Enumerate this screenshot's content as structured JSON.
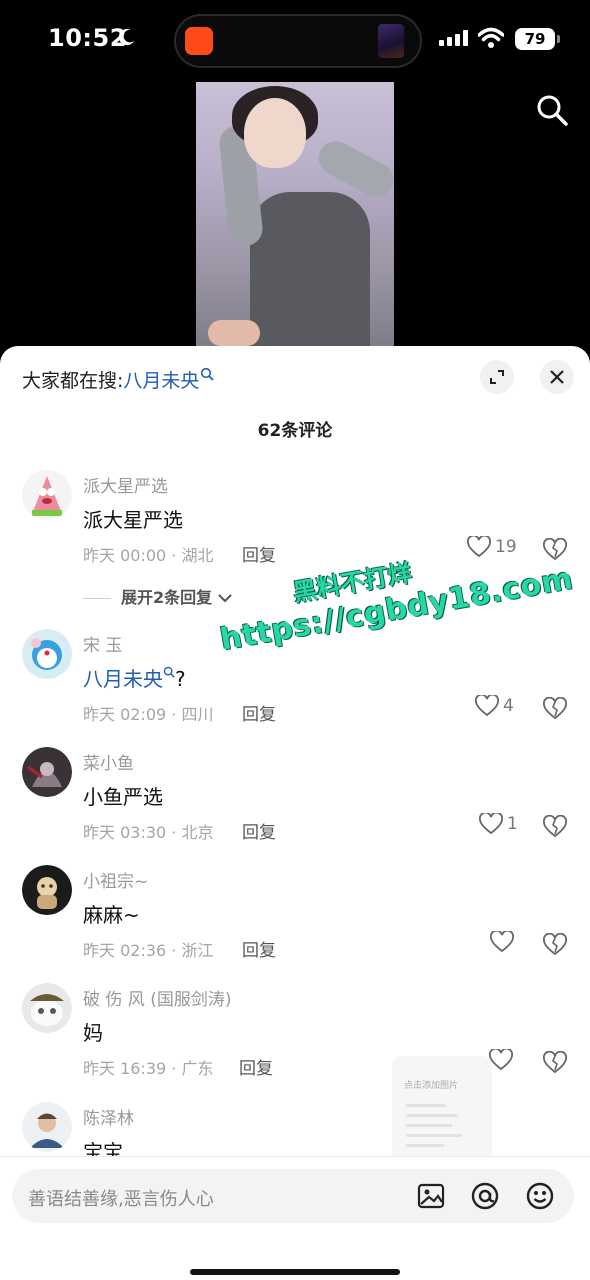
{
  "status_bar": {
    "time": "10:52",
    "battery": "79"
  },
  "sheet": {
    "search_prefix": "大家都在搜:",
    "search_keyword": "八月未央",
    "comment_count": "62条评论",
    "expand_replies": "展开2条回复"
  },
  "comments": [
    {
      "user": "派大星严选",
      "text": "派大星严选",
      "text_keyword": "",
      "text_suffix": "",
      "meta": "昨天 00:00 · 湖北",
      "reply": "回复",
      "likes": "19"
    },
    {
      "user": "宋 玉",
      "text": "",
      "text_keyword": "八月未央",
      "text_suffix": "?",
      "meta": "昨天 02:09 · 四川",
      "reply": "回复",
      "likes": "4"
    },
    {
      "user": "菜小鱼",
      "text": "小鱼严选",
      "text_keyword": "",
      "text_suffix": "",
      "meta": "昨天 03:30 · 北京",
      "reply": "回复",
      "likes": "1"
    },
    {
      "user": "小祖宗~",
      "text": "麻麻~",
      "text_keyword": "",
      "text_suffix": "",
      "meta": "昨天 02:36 · 浙江",
      "reply": "回复",
      "likes": ""
    },
    {
      "user": "破 伤 风 (国服剑涛)",
      "text": "妈",
      "text_keyword": "",
      "text_suffix": "",
      "meta": "昨天 16:39 · 广东",
      "reply": "回复",
      "likes": ""
    },
    {
      "user": "陈泽林",
      "text": "宝宝",
      "text_keyword": "",
      "text_suffix": "",
      "meta": "",
      "reply": "",
      "likes": ""
    }
  ],
  "watermark": {
    "line1": "黑料不打烊",
    "line2": "https://cgbdy18.com"
  },
  "photo_hint": "点击添加图片",
  "input": {
    "placeholder": "善语结善缘,恶言伤人心"
  },
  "colors": {
    "keyword": "#1f5db3",
    "watermark": "#26d8a8"
  }
}
